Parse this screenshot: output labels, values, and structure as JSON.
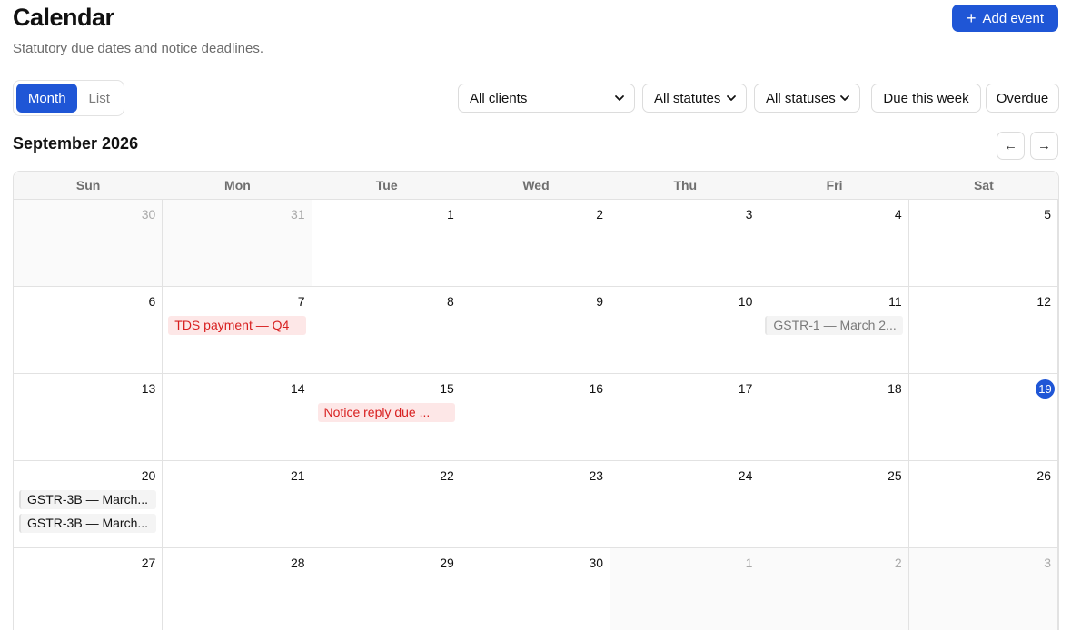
{
  "header": {
    "title": "Calendar",
    "subtitle": "Statutory due dates and notice deadlines.",
    "add_label": "Add event"
  },
  "view_toggle": {
    "month": "Month",
    "list": "List",
    "active": "Month"
  },
  "filters": {
    "clients": "All clients",
    "statutes": "All statutes",
    "statuses": "All statuses",
    "due_week": "Due this week",
    "overdue": "Overdue"
  },
  "month": {
    "label": "September 2026",
    "prev_icon": "←",
    "next_icon": "→"
  },
  "weekdays": [
    "Sun",
    "Mon",
    "Tue",
    "Wed",
    "Thu",
    "Fri",
    "Sat"
  ],
  "days": [
    {
      "n": "30",
      "muted": true,
      "events": []
    },
    {
      "n": "31",
      "muted": true,
      "events": []
    },
    {
      "n": "1",
      "events": []
    },
    {
      "n": "2",
      "events": []
    },
    {
      "n": "3",
      "events": []
    },
    {
      "n": "4",
      "events": []
    },
    {
      "n": "5",
      "events": []
    },
    {
      "n": "6",
      "events": []
    },
    {
      "n": "7",
      "events": [
        {
          "label": "TDS payment — Q4",
          "style": "red"
        }
      ]
    },
    {
      "n": "8",
      "events": []
    },
    {
      "n": "9",
      "events": []
    },
    {
      "n": "10",
      "events": []
    },
    {
      "n": "11",
      "events": [
        {
          "label": "GSTR-1 — March 2...",
          "style": "grey"
        }
      ]
    },
    {
      "n": "12",
      "events": []
    },
    {
      "n": "13",
      "events": []
    },
    {
      "n": "14",
      "events": []
    },
    {
      "n": "15",
      "events": [
        {
          "label": "Notice reply due ...",
          "style": "red"
        }
      ]
    },
    {
      "n": "16",
      "events": []
    },
    {
      "n": "17",
      "events": []
    },
    {
      "n": "18",
      "events": []
    },
    {
      "n": "19",
      "today": true,
      "events": []
    },
    {
      "n": "20",
      "events": [
        {
          "label": "GSTR-3B — March...",
          "style": "plain"
        },
        {
          "label": "GSTR-3B — March...",
          "style": "plain"
        }
      ]
    },
    {
      "n": "21",
      "events": []
    },
    {
      "n": "22",
      "events": []
    },
    {
      "n": "23",
      "events": []
    },
    {
      "n": "24",
      "events": []
    },
    {
      "n": "25",
      "events": []
    },
    {
      "n": "26",
      "events": []
    },
    {
      "n": "27",
      "events": []
    },
    {
      "n": "28",
      "events": []
    },
    {
      "n": "29",
      "events": []
    },
    {
      "n": "30",
      "events": []
    },
    {
      "n": "1",
      "muted": true,
      "events": []
    },
    {
      "n": "2",
      "muted": true,
      "events": []
    },
    {
      "n": "3",
      "muted": true,
      "events": []
    }
  ],
  "colors": {
    "accent": "#1f56d6",
    "overdue_bg": "#fde7e7",
    "overdue_text": "#d81f1f"
  }
}
